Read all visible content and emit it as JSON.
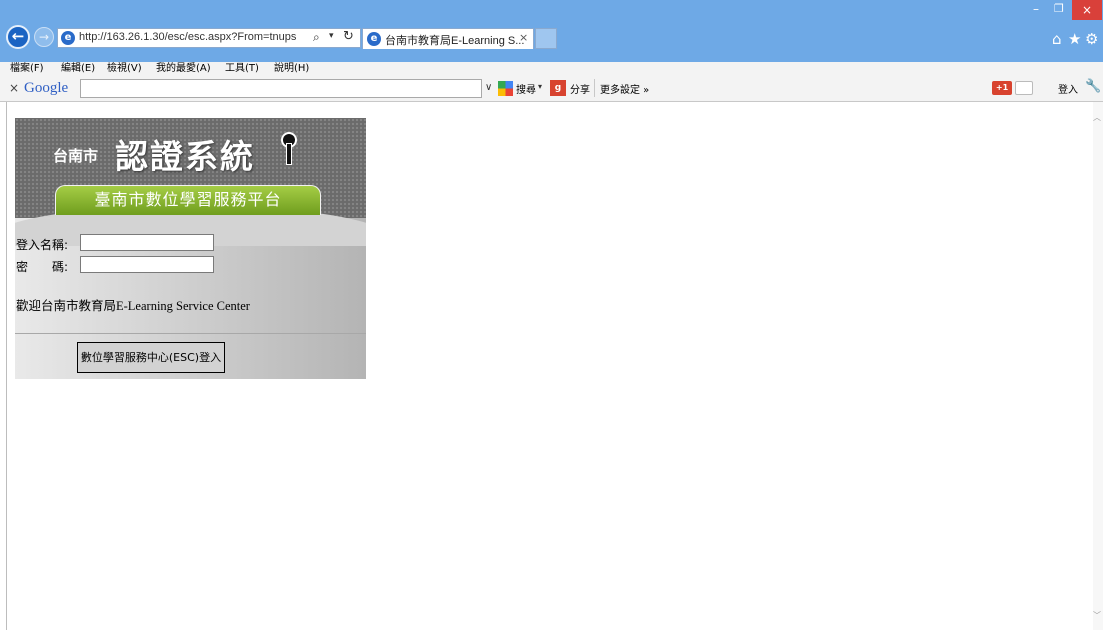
{
  "browser": {
    "url": "http://163.26.1.30/esc/esc.aspx?From=tnups",
    "tab_title": "台南市教育局E-Learning S...",
    "tab_close": "×",
    "window": {
      "minimize": "–",
      "restore": "❐",
      "close": "×"
    }
  },
  "menu": {
    "items": [
      "檔案(F)",
      "編輯(E)",
      "檢視(V)",
      "我的最愛(A)",
      "工具(T)",
      "說明(H)"
    ]
  },
  "google_toolbar": {
    "logo": "Google",
    "search_value": "",
    "search_label": "搜尋",
    "share_label": "分享",
    "more_settings": "更多設定 »",
    "plus_label": "+1",
    "login_label": "登入"
  },
  "login_panel": {
    "subtitle": "台南市",
    "title": "認證系統",
    "platform": "臺南市數位學習服務平台",
    "username_label": "登入名稱:",
    "username_value": "",
    "password_label": "密　　碼:",
    "password_value": "",
    "welcome": "歡迎台南市教育局E-Learning Service Center",
    "login_button": "數位學習服務中心(ESC)登入"
  },
  "colors": {
    "titlebar": "#6ea9e6",
    "green_bar": "#8ab833",
    "close_button": "#d9403a"
  }
}
